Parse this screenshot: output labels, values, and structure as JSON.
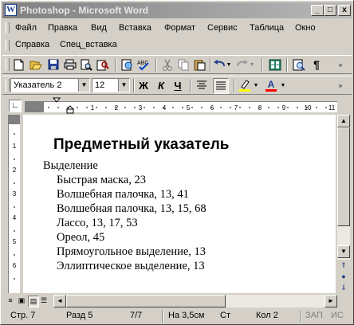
{
  "window": {
    "title": "Photoshop - Microsoft Word",
    "app_icon": "W",
    "caption_buttons": [
      "_",
      "□",
      "x"
    ]
  },
  "menu": {
    "row1": [
      "Файл",
      "Правка",
      "Вид",
      "Вставка",
      "Формат",
      "Сервис",
      "Таблица",
      "Окно"
    ],
    "row2": [
      "Справка",
      "Спец_вставка"
    ]
  },
  "formatting": {
    "style": "Указатель 2",
    "font_size": "12",
    "bold": "Ж",
    "italic": "К",
    "underline": "Ч",
    "font_color_label": "A"
  },
  "document": {
    "heading": "Предметный указатель",
    "entries": [
      "Выделение",
      "Быстрая маска, 23",
      "Волшебная палочка, 13, 41",
      "Волшебная палочка, 13, 15, 68",
      "Лассо, 13, 17, 53",
      "Ореол, 45",
      "Прямоугольное выделение, 13",
      "Эллиптическое выделение, 13"
    ]
  },
  "status": {
    "page": "Стр. 7",
    "section": "Разд 5",
    "pages": "7/7",
    "position": "На 3,5см",
    "line": "Ст",
    "column": "Кол 2",
    "rec": "ЗАП",
    "isp": "ИС"
  },
  "colors": {
    "highlight": "#ffff00",
    "font_color": "#ff0000",
    "title_bar": "#808080"
  }
}
